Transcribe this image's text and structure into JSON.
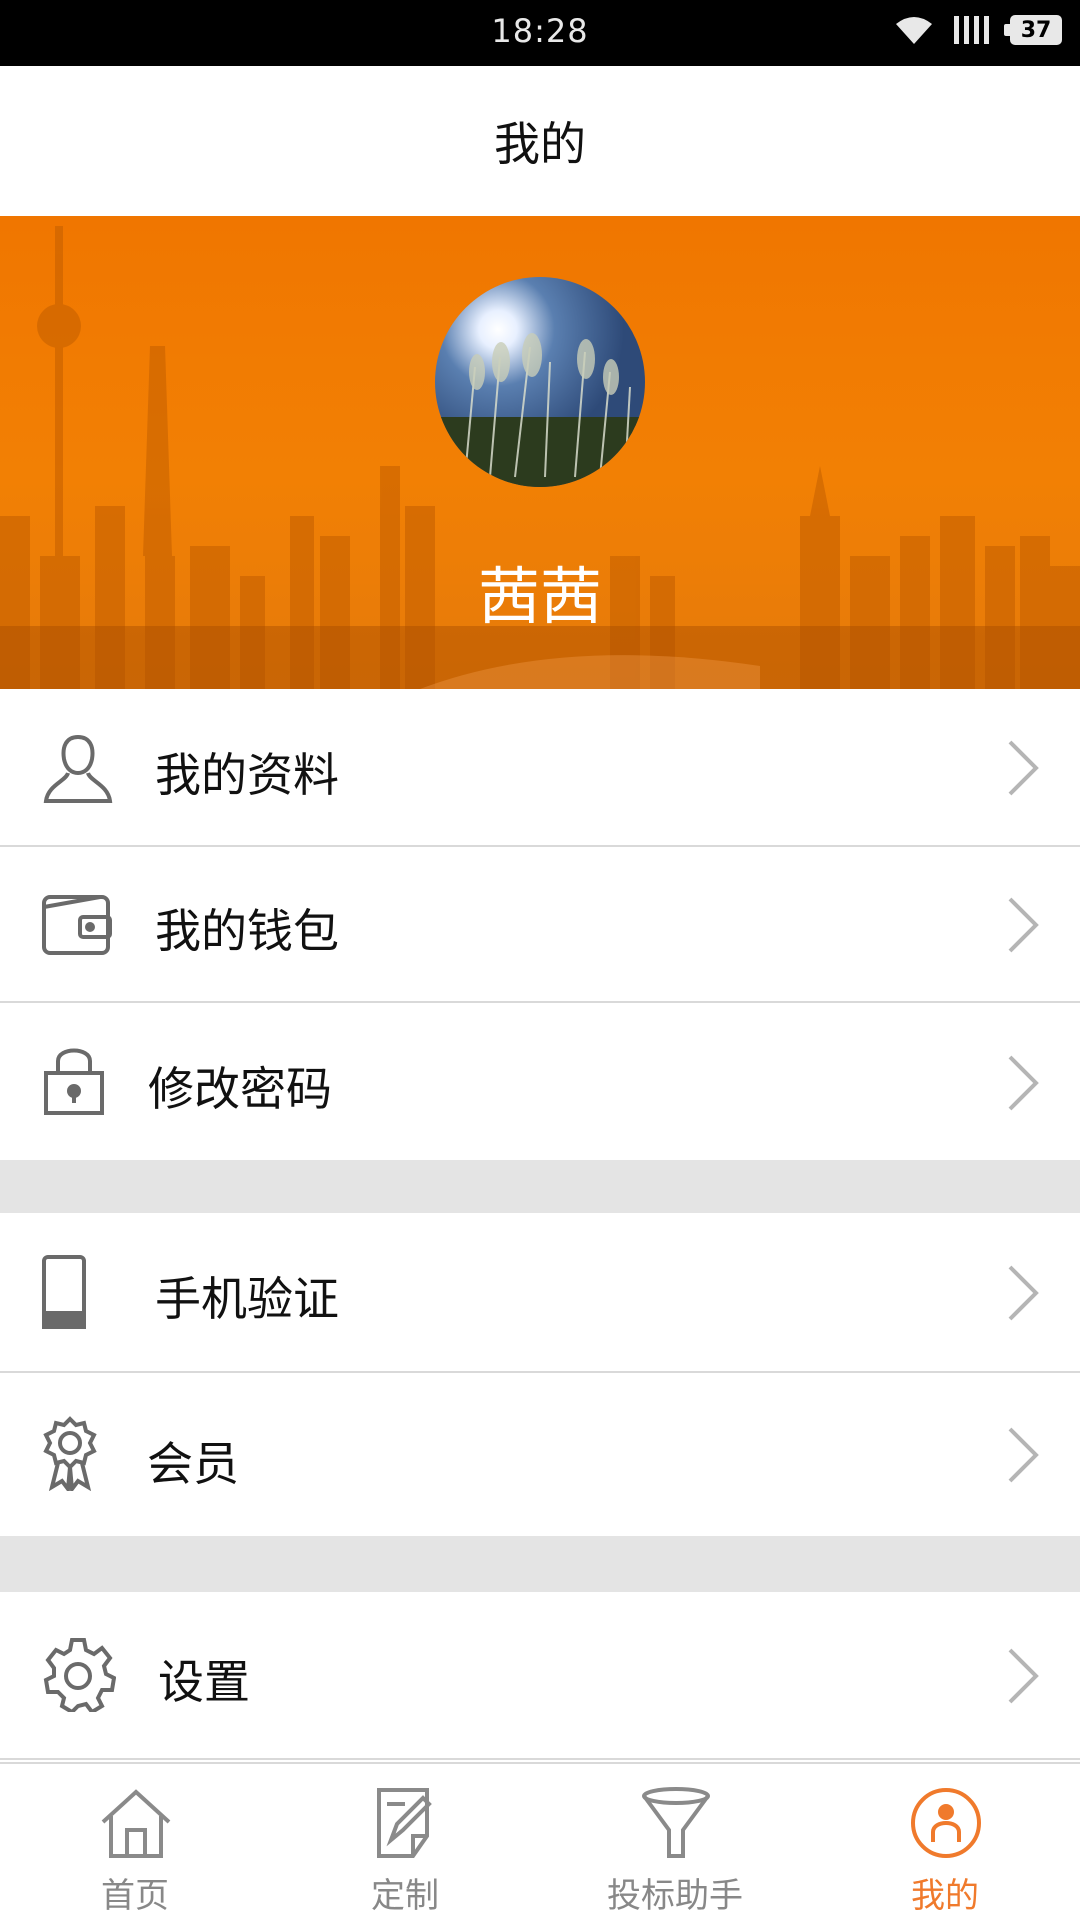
{
  "status_bar": {
    "time": "18:28",
    "battery": "37"
  },
  "header": {
    "title": "我的"
  },
  "profile": {
    "username": "茜茜"
  },
  "menu": {
    "items": [
      {
        "label": "我的资料",
        "icon": "user-icon"
      },
      {
        "label": "我的钱包",
        "icon": "wallet-icon"
      },
      {
        "label": "修改密码",
        "icon": "lock-icon"
      },
      {
        "label": "手机验证",
        "icon": "phone-icon"
      },
      {
        "label": "会员",
        "icon": "badge-icon"
      },
      {
        "label": "设置",
        "icon": "gear-icon"
      }
    ]
  },
  "tabs": [
    {
      "label": "首页",
      "icon": "home-icon"
    },
    {
      "label": "定制",
      "icon": "edit-icon"
    },
    {
      "label": "投标助手",
      "icon": "funnel-icon"
    },
    {
      "label": "我的",
      "icon": "user-circle-icon",
      "active": true
    }
  ],
  "colors": {
    "accent": "#f07a2c",
    "banner": "#f07600",
    "divider": "#e4e4e4"
  }
}
